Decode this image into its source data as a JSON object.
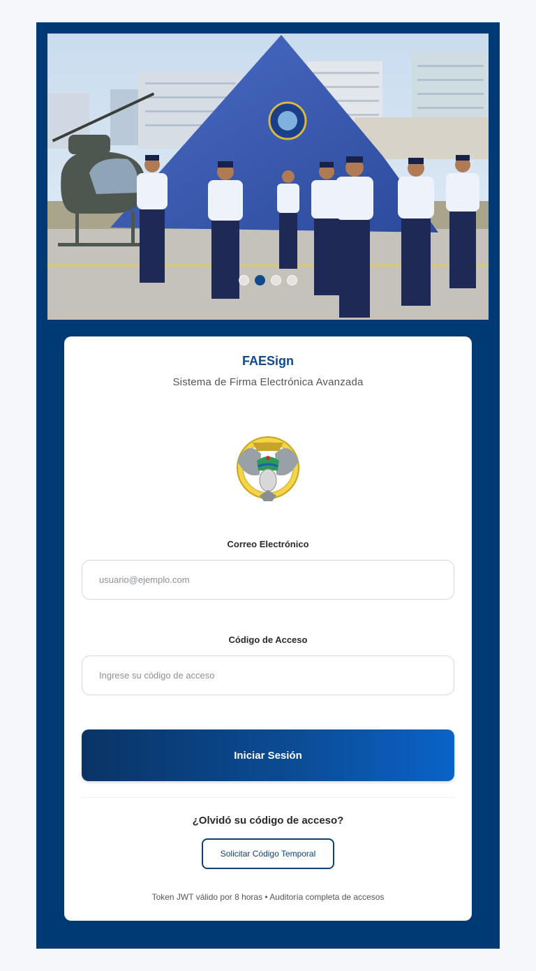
{
  "app": {
    "title": "FAESign",
    "subtitle": "Sistema de Firma Electrónica Avanzada"
  },
  "carousel": {
    "slide_count": 4,
    "active_index": 1
  },
  "form": {
    "email_label": "Correo Electrónico",
    "email_placeholder": "usuario@ejemplo.com",
    "email_value": "",
    "code_label": "Código de Acceso",
    "code_placeholder": "Ingrese su código de acceso",
    "code_value": "",
    "submit_label": "Iniciar Sesión"
  },
  "recovery": {
    "question": "¿Olvidó su código de acceso?",
    "button_label": "Solicitar Código Temporal"
  },
  "footer": {
    "text": "Token JWT válido por 8 horas • Auditoría completa de accesos"
  },
  "colors": {
    "frame": "#003a75",
    "brand": "#0f4a8a",
    "page_bg": "#f5f7fa"
  },
  "icons": {
    "logo": "fae-eagle-emblem-icon"
  }
}
